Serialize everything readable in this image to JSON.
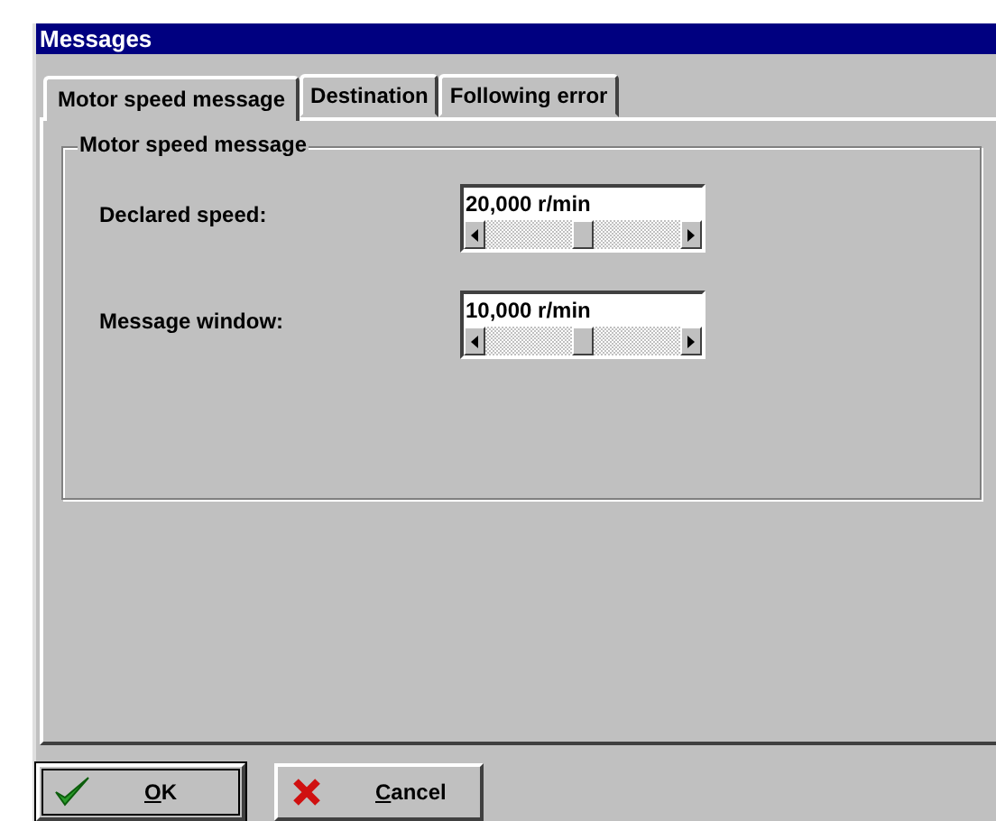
{
  "window": {
    "title": "Messages"
  },
  "tabs": [
    {
      "label": "Motor speed message",
      "selected": true
    },
    {
      "label": "Destination",
      "selected": false
    },
    {
      "label": "Following error",
      "selected": false
    }
  ],
  "group": {
    "title": "Motor speed message",
    "fields": [
      {
        "label": "Declared speed:",
        "value": "20,000  r/min",
        "level": 0.5
      },
      {
        "label": "Message window:",
        "value": "10,000  r/min",
        "level": 0.5
      }
    ]
  },
  "buttons": [
    {
      "kind": "ok",
      "label": "OK",
      "default": true
    },
    {
      "kind": "cancel",
      "label": "Cancel",
      "default": false
    }
  ]
}
